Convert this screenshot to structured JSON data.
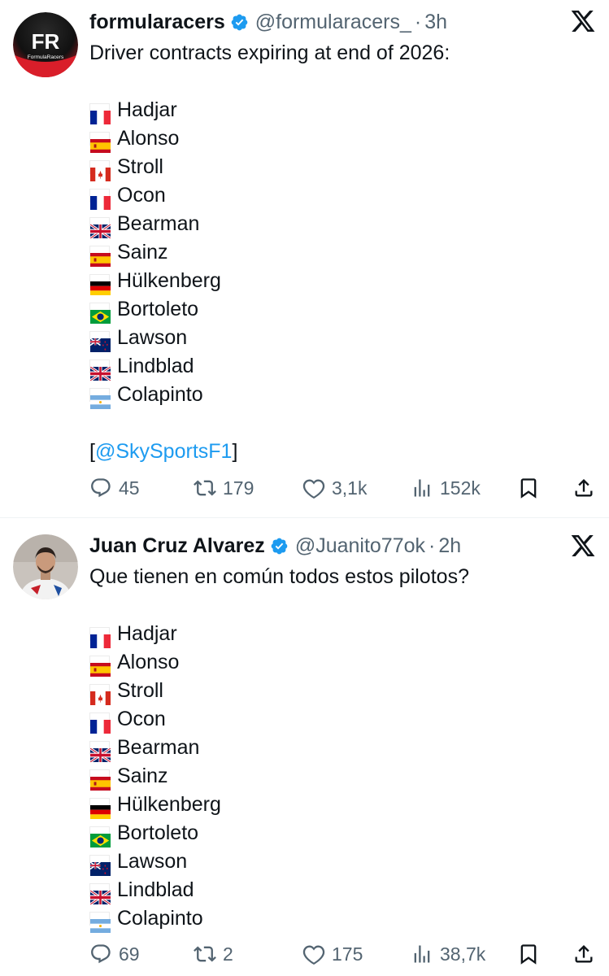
{
  "tweets": [
    {
      "author": {
        "name": "formularacers",
        "handle": "@formularacers_",
        "time": "3h",
        "avatar_text": "FR",
        "avatar_subtext": "FormulaRacers"
      },
      "intro": "Driver contracts expiring at end of 2026:",
      "drivers": [
        {
          "flag": "fr",
          "name": "Hadjar"
        },
        {
          "flag": "es",
          "name": "Alonso"
        },
        {
          "flag": "ca",
          "name": "Stroll"
        },
        {
          "flag": "fr",
          "name": "Ocon"
        },
        {
          "flag": "gb",
          "name": "Bearman"
        },
        {
          "flag": "es",
          "name": "Sainz"
        },
        {
          "flag": "de",
          "name": "Hülkenberg"
        },
        {
          "flag": "br",
          "name": "Bortoleto"
        },
        {
          "flag": "nz",
          "name": "Lawson"
        },
        {
          "flag": "gb",
          "name": "Lindblad"
        },
        {
          "flag": "ar",
          "name": "Colapinto"
        }
      ],
      "source": {
        "open": "[",
        "mention": "@SkySportsF1",
        "close": "]"
      },
      "stats": {
        "replies": "45",
        "retweets": "179",
        "likes": "3,1k",
        "views": "152k"
      }
    },
    {
      "author": {
        "name": "Juan Cruz Alvarez",
        "handle": "@Juanito77ok",
        "time": "2h"
      },
      "intro": "Que tienen en común todos estos pilotos?",
      "drivers": [
        {
          "flag": "fr",
          "name": "Hadjar"
        },
        {
          "flag": "es",
          "name": "Alonso"
        },
        {
          "flag": "ca",
          "name": "Stroll"
        },
        {
          "flag": "fr",
          "name": "Ocon"
        },
        {
          "flag": "gb",
          "name": "Bearman"
        },
        {
          "flag": "es",
          "name": "Sainz"
        },
        {
          "flag": "de",
          "name": "Hülkenberg"
        },
        {
          "flag": "br",
          "name": "Bortoleto"
        },
        {
          "flag": "nz",
          "name": "Lawson"
        },
        {
          "flag": "gb",
          "name": "Lindblad"
        },
        {
          "flag": "ar",
          "name": "Colapinto"
        }
      ],
      "stats": {
        "replies": "69",
        "retweets": "2",
        "likes": "175",
        "views": "38,7k"
      }
    }
  ],
  "ui": {
    "separator": "·",
    "icons": [
      "verified-badge-icon",
      "x-logo-icon",
      "reply-icon",
      "retweet-icon",
      "like-icon",
      "views-icon",
      "bookmark-icon",
      "share-icon"
    ],
    "colors": {
      "accent": "#1d9bf0",
      "muted": "#536471",
      "text": "#0f1419",
      "avatar_red": "#d91e2a"
    }
  }
}
